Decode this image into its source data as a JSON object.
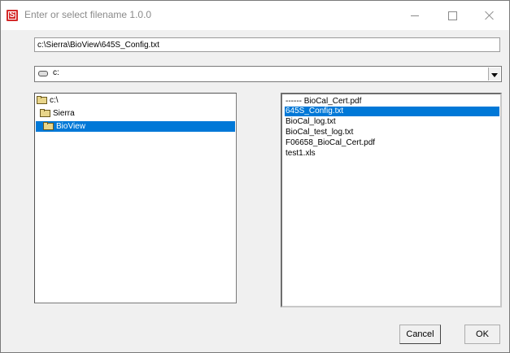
{
  "window": {
    "title": "Enter or select filename 1.0.0",
    "icon": "app-s-icon",
    "icon_letter": "S",
    "icon_color": "#d42a2a"
  },
  "path_field": {
    "value": "c:\\Sierra\\BioView\\645S_Config.txt"
  },
  "drive_select": {
    "selected": "c:",
    "icon": "drive-icon"
  },
  "folders": [
    {
      "label": "c:\\",
      "icon": "open-folder-icon",
      "selected": false
    },
    {
      "label": "Sierra",
      "icon": "open-folder-icon",
      "selected": false
    },
    {
      "label": "BioView",
      "icon": "open-folder-icon",
      "selected": true
    }
  ],
  "files": [
    {
      "label": "------  BioCal_Cert.pdf",
      "selected": false
    },
    {
      "label": "645S_Config.txt",
      "selected": true
    },
    {
      "label": "BioCal_log.txt",
      "selected": false
    },
    {
      "label": "BioCal_test_log.txt",
      "selected": false
    },
    {
      "label": "F06658_BioCal_Cert.pdf",
      "selected": false
    },
    {
      "label": "test1.xls",
      "selected": false
    }
  ],
  "buttons": {
    "cancel": "Cancel",
    "ok": "OK"
  },
  "colors": {
    "selection": "#0078d7",
    "app_icon": "#d42a2a"
  }
}
